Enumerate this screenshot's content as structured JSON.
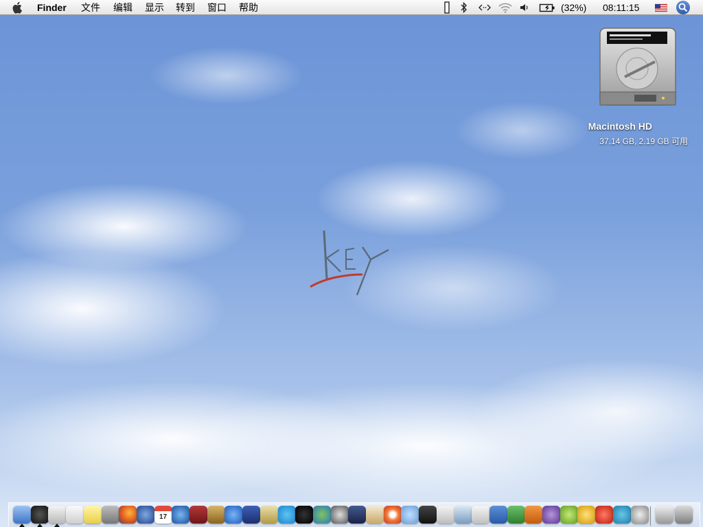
{
  "menubar": {
    "app_name": "Finder",
    "menus": [
      "文件",
      "编辑",
      "显示",
      "转到",
      "窗口",
      "帮助"
    ],
    "status": {
      "battery_percent": "(32%)",
      "clock": "08:11:15",
      "icons": [
        "input-box-icon",
        "bluetooth-icon",
        "network-arrows-icon",
        "wifi-icon",
        "volume-icon",
        "battery-charging-icon",
        "us-flag-icon",
        "spotlight-icon"
      ]
    }
  },
  "desktop": {
    "drive": {
      "name": "Macintosh HD",
      "info": "37.14 GB, 2.19 GB 可用"
    },
    "wallpaper_logo": "KEY"
  },
  "dock": {
    "apps": [
      "finder",
      "dashboard",
      "preview",
      "system-info",
      "stickies",
      "calculator",
      "firefox",
      "thunderbird",
      "ical",
      "google-earth",
      "dictionary",
      "package",
      "forward",
      "gimp",
      "adium",
      "skype",
      "qq",
      "msn",
      "webcam",
      "final-cut",
      "mail-stamp",
      "safari",
      "itunes",
      "activity-monitor",
      "ipod",
      "scripts",
      "textedit",
      "word",
      "excel",
      "powerpoint",
      "entourage",
      "dreamweaver",
      "fireworks",
      "flash",
      "contribute",
      "chrome-ball"
    ],
    "calendar_day": "17",
    "trash": "trash"
  },
  "colors": {
    "menubar_bg": "#f0f0f0",
    "sky": "#6f9ad8",
    "logo_red": "#c23a2a"
  }
}
